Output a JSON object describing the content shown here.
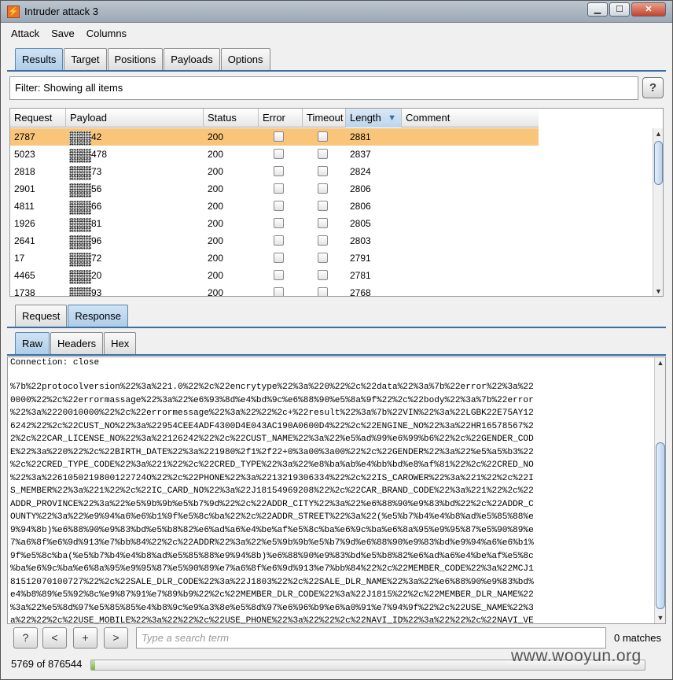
{
  "window": {
    "title": "Intruder attack 3",
    "app_icon": "burp-flame-icon",
    "minimize_icon": "minimize-icon",
    "maximize_icon": "maximize-icon",
    "close_icon": "close-icon"
  },
  "menu": [
    "Attack",
    "Save",
    "Columns"
  ],
  "main_tabs": [
    {
      "label": "Results",
      "active": true
    },
    {
      "label": "Target"
    },
    {
      "label": "Positions"
    },
    {
      "label": "Payloads"
    },
    {
      "label": "Options"
    }
  ],
  "filter": {
    "text": "Filter: Showing all items",
    "help_label": "?"
  },
  "results_table": {
    "columns": [
      "Request",
      "Payload",
      "Status",
      "Error",
      "Timeout",
      "Length",
      "Comment"
    ],
    "sorted_column": "Length",
    "sort_direction": "descending",
    "rows": [
      {
        "request": "2787",
        "payload_tail": "42",
        "status": "200",
        "error": false,
        "timeout": false,
        "length": "2881",
        "comment": "",
        "selected": true
      },
      {
        "request": "5023",
        "payload_tail": "478",
        "status": "200",
        "error": false,
        "timeout": false,
        "length": "2837",
        "comment": ""
      },
      {
        "request": "2818",
        "payload_tail": "73",
        "status": "200",
        "error": false,
        "timeout": false,
        "length": "2824",
        "comment": ""
      },
      {
        "request": "2901",
        "payload_tail": "56",
        "status": "200",
        "error": false,
        "timeout": false,
        "length": "2806",
        "comment": ""
      },
      {
        "request": "4811",
        "payload_tail": "66",
        "status": "200",
        "error": false,
        "timeout": false,
        "length": "2806",
        "comment": ""
      },
      {
        "request": "1926",
        "payload_tail": "81",
        "status": "200",
        "error": false,
        "timeout": false,
        "length": "2805",
        "comment": ""
      },
      {
        "request": "2641",
        "payload_tail": "96",
        "status": "200",
        "error": false,
        "timeout": false,
        "length": "2803",
        "comment": ""
      },
      {
        "request": "17",
        "payload_tail": "72",
        "status": "200",
        "error": false,
        "timeout": false,
        "length": "2791",
        "comment": ""
      },
      {
        "request": "4465",
        "payload_tail": "20",
        "status": "200",
        "error": false,
        "timeout": false,
        "length": "2781",
        "comment": ""
      },
      {
        "request": "1738",
        "payload_tail": "93",
        "status": "200",
        "error": false,
        "timeout": false,
        "length": "2768",
        "comment": ""
      }
    ]
  },
  "detail_tabs": [
    {
      "label": "Request"
    },
    {
      "label": "Response",
      "active": true
    }
  ],
  "view_tabs": [
    {
      "label": "Raw",
      "active": true
    },
    {
      "label": "Headers"
    },
    {
      "label": "Hex"
    }
  ],
  "response": {
    "lines": [
      "Connection: close",
      "",
      "%7b%22protocolversion%22%3a%221.0%22%2c%22encrytype%22%3a%220%22%2c%22data%22%3a%7b%22error%22%3a%22",
      "0000%22%2c%22errormassage%22%3a%22%e6%93%8d%e4%bd%9c%e6%88%90%e5%8a%9f%22%2c%22body%22%3a%7b%22error",
      "%22%3a%2220010000%22%2c%22errormessage%22%3a%22%22%2c+%22result%22%3a%7b%22VIN%22%3a%22LGBK22E75AY12",
      "6242%22%2c%22CUST_NO%22%3a%22954CEE4ADF4300D4E043AC190A0600D4%22%2c%22ENGINE_NO%22%3a%22HR16578567%2",
      "2%2c%22CAR_LICENSE_NO%22%3a%22126242%22%2c%22CUST_NAME%22%3a%22%e5%ad%99%e6%99%b6%22%2c%22GENDER_COD",
      "E%22%3a%220%22%2c%22BIRTH_DATE%22%3a%221980%2f1%2f22+0%3a00%3a00%22%2c%22GENDER%22%3a%22%e5%a5%b3%22",
      "%2c%22CRED_TYPE_CODE%22%3a%221%22%2c%22CRED_TYPE%22%3a%22%e8%ba%ab%e4%bb%bd%e8%af%81%22%2c%22CRED_NO",
      "%22%3a%2261050219800122724O%22%2c%22PHONE%22%3a%2213219306334%22%2c%22IS_CAROWER%22%3a%221%22%2c%22I",
      "S_MEMBER%22%3a%221%22%2c%22IC_CARD_NO%22%3a%22J18154969208%22%2c%22CAR_BRAND_CODE%22%3a%221%22%2c%22",
      "ADDR_PROVINCE%22%3a%22%e5%9b%9b%e5%b7%9d%22%2c%22ADDR_CITY%22%3a%22%e6%88%90%e9%83%bd%22%2c%22ADDR_C",
      "OUNTY%22%3a%22%e9%94%a6%e6%b1%9f%e5%8c%ba%22%2c%22ADDR_STREET%22%3a%22(%e5%b7%b4%e4%b8%ad%e5%85%88%e",
      "9%94%8b)%e6%88%90%e9%83%bd%e5%b8%82%e6%ad%a6%e4%be%af%e5%8c%ba%e6%9c%ba%e6%8a%95%e9%95%87%e5%90%89%e",
      "7%a6%8f%e6%9d%913%e7%bb%84%22%2c%22ADDR%22%3a%22%e5%9b%9b%e5%b7%9d%e6%88%90%e9%83%bd%e9%94%a6%e6%b1%",
      "9f%e5%8c%ba(%e5%b7%b4%e4%b8%ad%e5%85%88%e9%94%8b)%e6%88%90%e9%83%bd%e5%b8%82%e6%ad%a6%e4%be%af%e5%8c",
      "%ba%e6%9c%ba%e6%8a%95%e9%95%87%e5%90%89%e7%a6%8f%e6%9d%913%e7%bb%84%22%2c%22MEMBER_CODE%22%3a%22MCJ1",
      "81512070100727%22%2c%22SALE_DLR_CODE%22%3a%22J1803%22%2c%22SALE_DLR_NAME%22%3a%22%e6%88%90%e9%83%bd%",
      "e4%b8%89%e5%92%8c%e9%87%91%e7%89%b9%22%2c%22MEMBER_DLR_CODE%22%3a%22J1815%22%2c%22MEMBER_DLR_NAME%22",
      "%3a%22%e5%8d%97%e5%85%85%e4%b8%9c%e9%a3%8e%e5%8d%97%e6%96%b9%e6%a0%91%e7%94%9f%22%2c%22USE_NAME%22%3",
      "a%22%22%2c%22USE_MOBILE%22%3a%22%22%2c%22USE_PHONE%22%3a%22%22%2c%22NAVI_ID%22%3a%22%22%2c%22NAVI_VE"
    ]
  },
  "bottom": {
    "help": "?",
    "prev": "<",
    "add": "+",
    "next": ">",
    "search_placeholder": "Type a search term",
    "matches": "0 matches"
  },
  "status": {
    "progress_text": "5769 of 876544",
    "progress_fraction": 0.0066
  },
  "watermark": "www.wooyun.org"
}
